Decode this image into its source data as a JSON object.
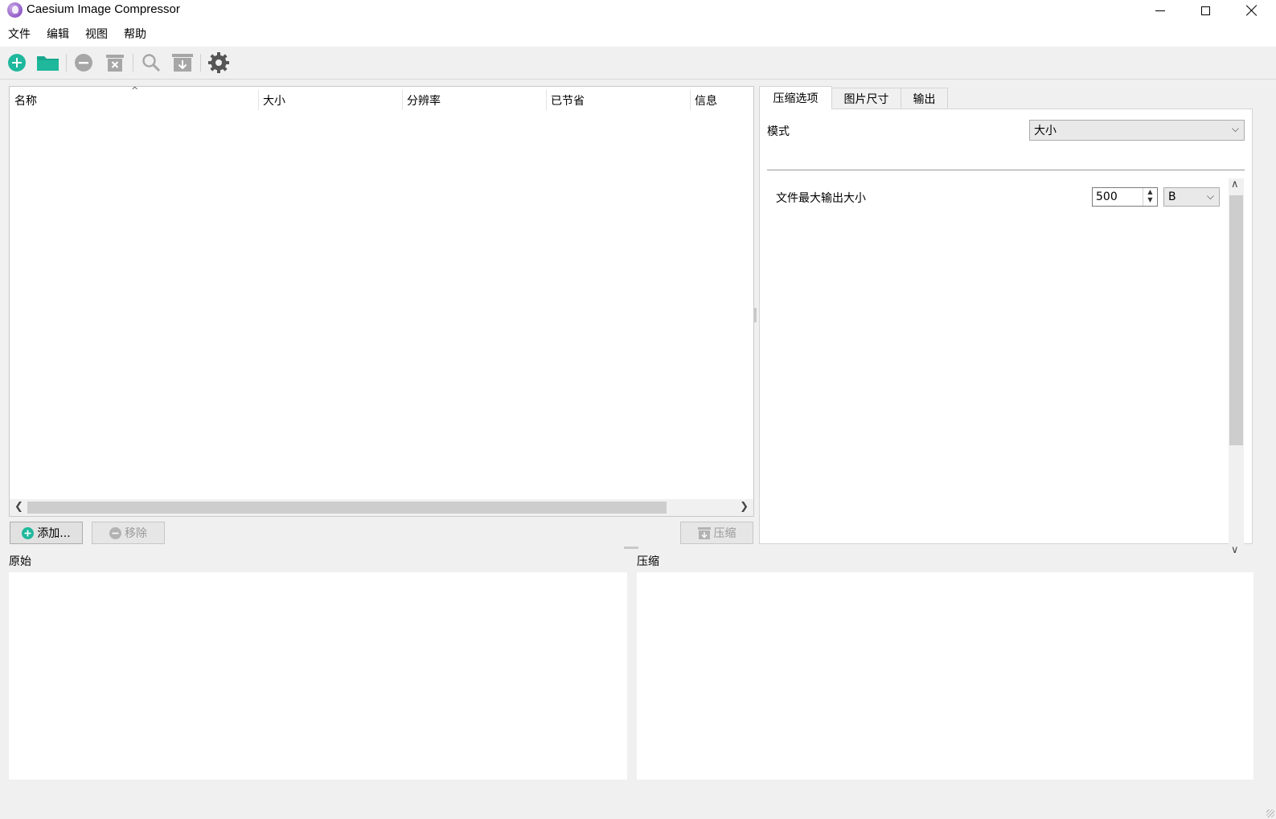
{
  "window": {
    "title": "Caesium Image Compressor"
  },
  "menu": {
    "items": [
      "文件",
      "编辑",
      "视图",
      "帮助"
    ]
  },
  "toolbar": {
    "icons": [
      "add-file-icon",
      "open-folder-icon",
      "remove-icon",
      "clear-list-icon",
      "preview-icon",
      "compress-icon",
      "settings-icon"
    ],
    "colors": {
      "accent": "#1fb89c",
      "disabled": "#a6a6a6",
      "settings": "#555555"
    }
  },
  "file_list": {
    "columns": [
      "名称",
      "大小",
      "分辨率",
      "已节省",
      "信息"
    ],
    "sort_indicator": "^",
    "rows": []
  },
  "actions": {
    "add_label": "添加...",
    "remove_label": "移除",
    "compress_label": "压缩"
  },
  "options": {
    "tabs": [
      "压缩选项",
      "图片尺寸",
      "输出"
    ],
    "active_tab": 0,
    "mode_label": "模式",
    "mode_value": "大小",
    "max_size_label": "文件最大输出大小",
    "max_size_value": "500",
    "max_size_unit": "B"
  },
  "preview": {
    "original_label": "原始",
    "compressed_label": "压缩"
  }
}
